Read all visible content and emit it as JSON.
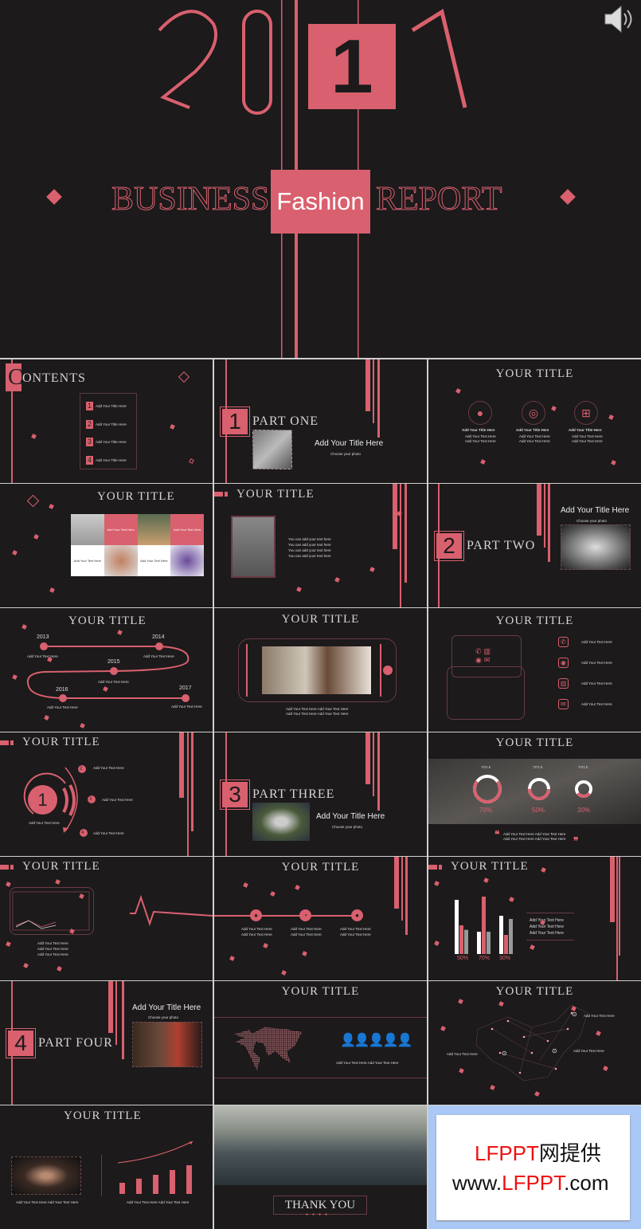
{
  "colors": {
    "accent": "#d9606e",
    "background": "#1c1a1b",
    "thumb_border": "#a9c8f5"
  },
  "cover": {
    "digits": [
      "2",
      "0",
      "1",
      "7"
    ],
    "business": "BUSINESS",
    "fashion": "Fashion",
    "report": "REPORT",
    "audio_icon": "speaker-icon"
  },
  "contents": {
    "c": "C",
    "rest": "ONTENTS",
    "items": [
      {
        "n": "1",
        "label": "Add Your Title Here"
      },
      {
        "n": "2",
        "label": "Add Your Title Here"
      },
      {
        "n": "3",
        "label": "Add Your Title Here"
      },
      {
        "n": "4",
        "label": "Add Your Title Here"
      }
    ]
  },
  "part_one": {
    "n": "1",
    "label": "PART ONE",
    "title": "Add Your Title Here",
    "sub": "Choose your photo"
  },
  "s3": {
    "title": "YOUR TITLE",
    "cols": [
      {
        "icon": "foot-icon",
        "head": "Add Your Title Here",
        "l1": "Add Your Text Here",
        "l2": "Add Your Text Here"
      },
      {
        "icon": "target-icon",
        "head": "Add Your Title Here",
        "l1": "Add Your Text Here",
        "l2": "Add Your Text Here"
      },
      {
        "icon": "grid-icon",
        "head": "Add Your Title Here",
        "l1": "Add Your Text Here",
        "l2": "Add Your Text Here"
      }
    ]
  },
  "s4": {
    "title": "YOUR TITLE",
    "cells": [
      "",
      "Add Your Text Here",
      "",
      "Add Your Text Here",
      "Add Your Text Here",
      "",
      "Add Your Text Here",
      ""
    ]
  },
  "s5": {
    "title": "YOUR TITLE",
    "lines": [
      "You can add your text here",
      "You can add your text here",
      "You can add your text here",
      "You can add your text here"
    ]
  },
  "part_two": {
    "n": "2",
    "label": "PART TWO",
    "title": "Add Your Title Here",
    "sub": "Choose your photo"
  },
  "s7": {
    "title": "YOUR TITLE",
    "years": [
      {
        "y": "2013",
        "t": "Add Your Text Here"
      },
      {
        "y": "2014",
        "t": "Add Your Text Here"
      },
      {
        "y": "2015",
        "t": "Add Your Text Here"
      },
      {
        "y": "2016",
        "t": "Add Your Text Here"
      },
      {
        "y": "2017",
        "t": "Add Your Text Here"
      }
    ]
  },
  "s8": {
    "title": "YOUR TITLE",
    "l1": "Add Your Text Here Add Your Text Here",
    "l2": "Add Your Text Here Add Your Text Here"
  },
  "s9": {
    "title": "YOUR TITLE",
    "items": [
      {
        "icon": "phone-icon",
        "t": "Add Your Text Here"
      },
      {
        "icon": "eye-icon",
        "t": "Add Your Text Here"
      },
      {
        "icon": "chart-icon",
        "t": "Add Your Text Here"
      },
      {
        "icon": "mail-icon",
        "t": "Add Your Text Here"
      }
    ]
  },
  "s10": {
    "title": "YOUR TITLE",
    "main": "1",
    "main_text": "Add Your Text Here",
    "steps": [
      {
        "n": "2",
        "t": "Add Your Text Here"
      },
      {
        "n": "3",
        "t": "Add Your Text Here"
      },
      {
        "n": "4",
        "t": "Add Your Text Here"
      }
    ]
  },
  "part_three": {
    "n": "3",
    "label": "PART THREE",
    "title": "Add Your Title Here",
    "sub": "Choose your photo"
  },
  "s12": {
    "title": "YOUR TITLE",
    "donuts": [
      {
        "label": "TITLE",
        "value": 70,
        "pct": "70%"
      },
      {
        "label": "TITLE",
        "value": 50,
        "pct": "50%"
      },
      {
        "label": "TITLE",
        "value": 30,
        "pct": "30%"
      }
    ],
    "q1": "Add Your Text Here Add Your Text Here",
    "q2": "Add Your Text Here Add Your Text Here"
  },
  "s13": {
    "title": "YOUR TITLE",
    "lines": [
      "Add  Your  Text Here",
      "Add  Your  Text Here",
      "Add  Your  Text Here"
    ]
  },
  "s14": {
    "title": "YOUR TITLE",
    "nodes": [
      {
        "icon": "bell-icon",
        "l1": "Add Your Text Here",
        "l2": "Add Your Text Here"
      },
      {
        "icon": "weibo-icon",
        "l1": "Add Your Text Here",
        "l2": "Add Your Text Here"
      },
      {
        "icon": "wechat-icon",
        "l1": "Add Your Text Here",
        "l2": "Add Your Text Here"
      }
    ]
  },
  "s15": {
    "title": "YOUR TITLE",
    "groups": [
      {
        "pct": "50%",
        "bars": [
          0.85,
          0.45,
          0.38
        ]
      },
      {
        "pct": "70%",
        "bars": [
          0.35,
          0.9,
          0.35
        ]
      },
      {
        "pct": "30%",
        "bars": [
          0.6,
          0.3,
          0.55
        ]
      }
    ],
    "lines": [
      "Add  Your  Text Here",
      "Add  Your  Text Here",
      "Add  Your  Text Here"
    ]
  },
  "part_four": {
    "n": "4",
    "label": "PART FOUR",
    "title": "Add Your Title Here",
    "sub": "Choose your photo"
  },
  "s17": {
    "title": "YOUR TITLE",
    "text": "Add Your Text Here Add Your Text Here"
  },
  "s18": {
    "title": "YOUR TITLE",
    "t1": "Add  Your  Text Here",
    "t2": "Add  Your  Text Here",
    "t3": "Add  Your  Text Here"
  },
  "s19": {
    "title": "YOUR TITLE",
    "bars": [
      0.35,
      0.48,
      0.6,
      0.75,
      0.9
    ],
    "t1": "Add Your Text Here Add Your Text Here",
    "t2": "Add Your Text Here Add Your Text Here"
  },
  "s20": {
    "thanks": "THANK YOU"
  },
  "s21": {
    "brand_red": "LFPPT",
    "brand_rest": "网提供",
    "url_a": "www.",
    "url_red": "LFPPT",
    "url_b": ".com"
  }
}
